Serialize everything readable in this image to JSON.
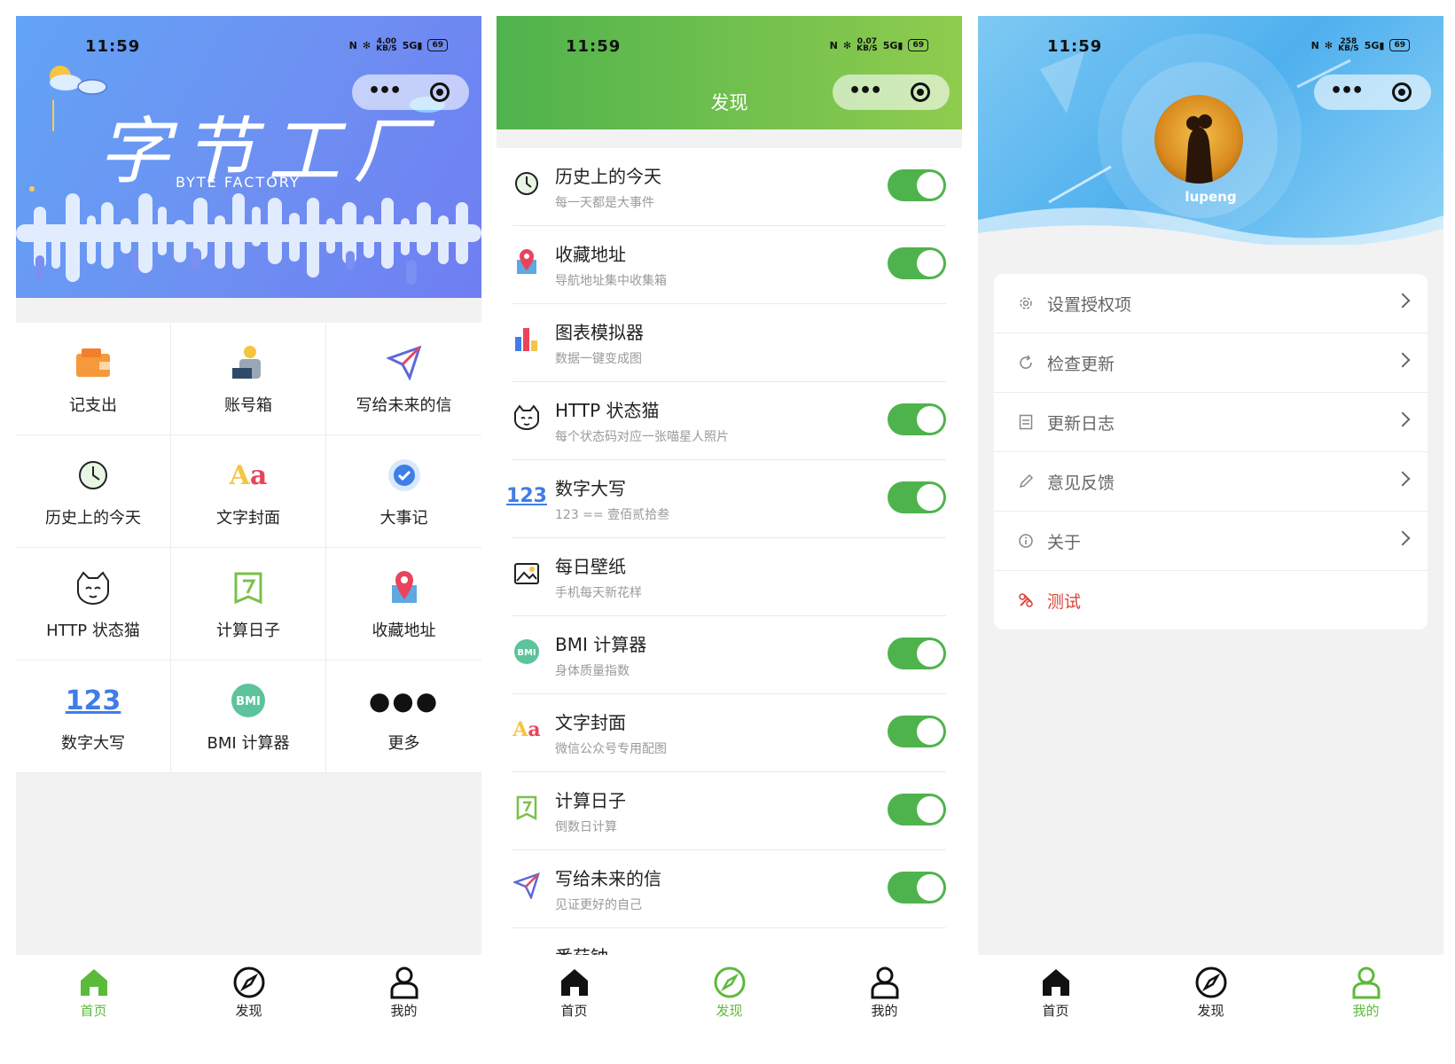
{
  "status": {
    "time": "11:59",
    "battery": "69",
    "signal": "5G",
    "speed_unit": "KB/S",
    "speeds": [
      "4.00",
      "0.07",
      "258"
    ]
  },
  "home": {
    "banner_title": "字节工厂",
    "banner_subtitle": "BYTE FACTORY",
    "grid": [
      {
        "label": "记支出",
        "icon": "wallet-icon"
      },
      {
        "label": "账号箱",
        "icon": "account-icon"
      },
      {
        "label": "写给未来的信",
        "icon": "paper-plane-icon"
      },
      {
        "label": "历史上的今天",
        "icon": "clock-icon"
      },
      {
        "label": "文字封面",
        "icon": "text-aa-icon"
      },
      {
        "label": "大事记",
        "icon": "check-badge-icon"
      },
      {
        "label": "HTTP 状态猫",
        "icon": "cat-icon"
      },
      {
        "label": "计算日子",
        "icon": "calendar-7-icon"
      },
      {
        "label": "收藏地址",
        "icon": "map-pin-icon"
      },
      {
        "label": "数字大写",
        "icon": "numbers-123-icon"
      },
      {
        "label": "BMI 计算器",
        "icon": "bmi-icon"
      },
      {
        "label": "更多",
        "icon": "more-dots-icon"
      }
    ]
  },
  "discover": {
    "title": "发现",
    "items": [
      {
        "title": "历史上的今天",
        "subtitle": "每一天都是大事件",
        "toggle": true,
        "icon": "clock-icon"
      },
      {
        "title": "收藏地址",
        "subtitle": "导航地址集中收集箱",
        "toggle": true,
        "icon": "map-pin-icon"
      },
      {
        "title": "图表模拟器",
        "subtitle": "数据一键变成图",
        "toggle": false,
        "icon": "bar-chart-icon"
      },
      {
        "title": "HTTP 状态猫",
        "subtitle": "每个状态码对应一张喵星人照片",
        "toggle": true,
        "icon": "cat-icon"
      },
      {
        "title": "数字大写",
        "subtitle": "123 == 壹佰贰拾叁",
        "toggle": true,
        "icon": "numbers-123-icon"
      },
      {
        "title": "每日壁纸",
        "subtitle": "手机每天新花样",
        "toggle": false,
        "icon": "image-icon"
      },
      {
        "title": "BMI 计算器",
        "subtitle": "身体质量指数",
        "toggle": true,
        "icon": "bmi-icon"
      },
      {
        "title": "文字封面",
        "subtitle": "微信公众号专用配图",
        "toggle": true,
        "icon": "text-aa-icon"
      },
      {
        "title": "计算日子",
        "subtitle": "倒数日计算",
        "toggle": true,
        "icon": "calendar-7-icon"
      },
      {
        "title": "写给未来的信",
        "subtitle": "见证更好的自己",
        "toggle": true,
        "icon": "paper-plane-icon"
      },
      {
        "title": "番茄钟",
        "subtitle": "",
        "toggle": false,
        "icon": "tomato-icon"
      }
    ]
  },
  "profile": {
    "username": "lupeng",
    "menu": [
      {
        "label": "设置授权项",
        "icon": "gear-icon",
        "arrow": true
      },
      {
        "label": "检查更新",
        "icon": "refresh-icon",
        "arrow": true
      },
      {
        "label": "更新日志",
        "icon": "log-icon",
        "arrow": true
      },
      {
        "label": "意见反馈",
        "icon": "pencil-icon",
        "arrow": true
      },
      {
        "label": "关于",
        "icon": "info-icon",
        "arrow": true
      },
      {
        "label": "测试",
        "icon": "tools-icon",
        "arrow": false
      }
    ]
  },
  "tabs": [
    {
      "label": "首页",
      "icon": "home-icon"
    },
    {
      "label": "发现",
      "icon": "compass-icon"
    },
    {
      "label": "我的",
      "icon": "person-icon"
    }
  ],
  "colors": {
    "accent_green": "#5cba3b",
    "toggle_green": "#4fb34d",
    "test_red": "#d9473b"
  }
}
